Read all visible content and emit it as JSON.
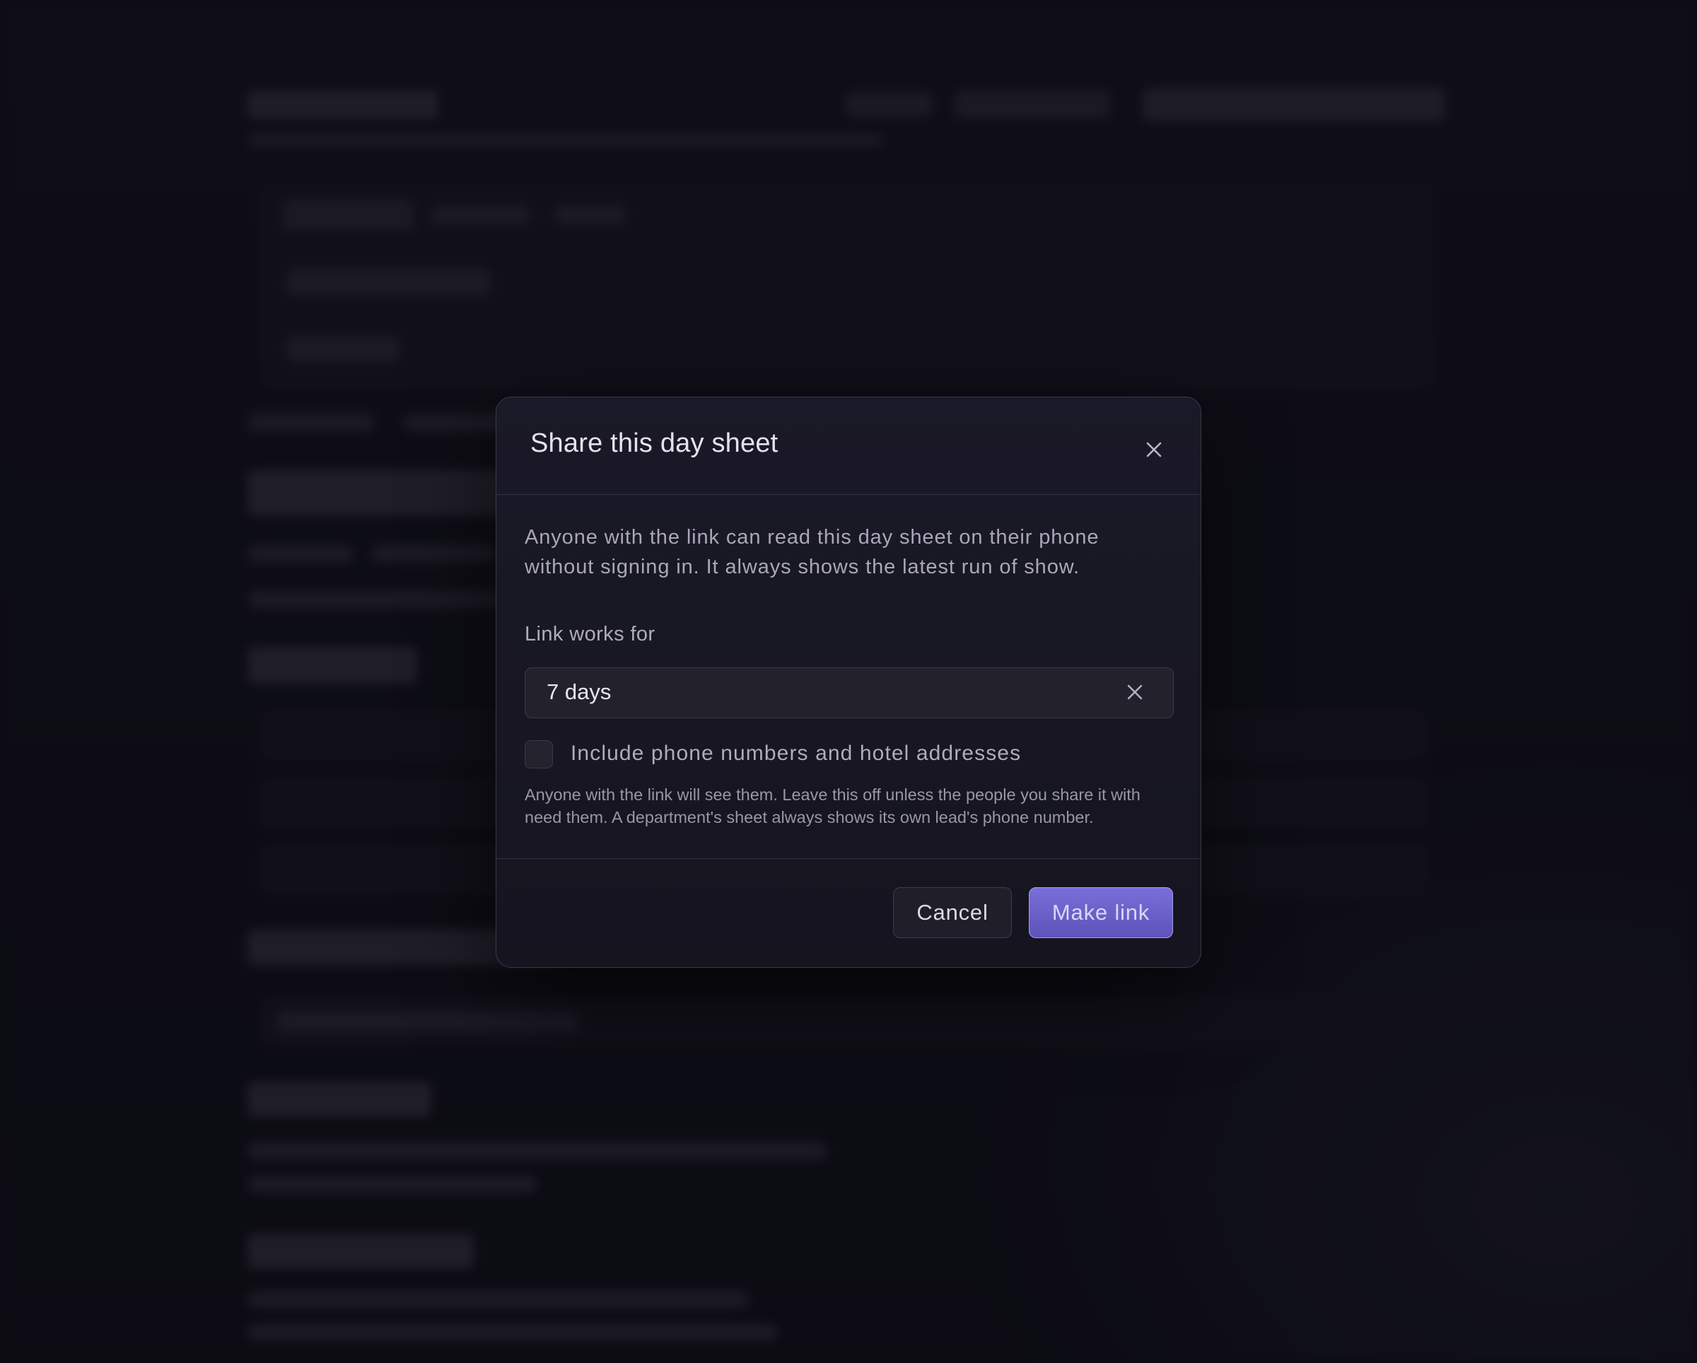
{
  "dialog": {
    "title": "Share this day sheet",
    "description": "Anyone with the link can read this day sheet on their phone without signing in. It always shows the latest run of show.",
    "expiry": {
      "label": "Link works for",
      "value": "7 days"
    },
    "include_contacts": {
      "label": "Include phone numbers and hotel addresses",
      "checked": false,
      "hint": "Anyone with the link will see them. Leave this off unless the people you share it with need them. A department's sheet always shows its own lead's phone number."
    },
    "actions": {
      "cancel_label": "Cancel",
      "confirm_label": "Make link"
    }
  },
  "icons": {
    "close": "close-icon",
    "clear": "clear-icon"
  },
  "colors": {
    "background": "#0f0e18",
    "dialog_surface": "#1a1927",
    "primary_button": "#6a5fcb",
    "primary_border": "#a69ef0"
  }
}
